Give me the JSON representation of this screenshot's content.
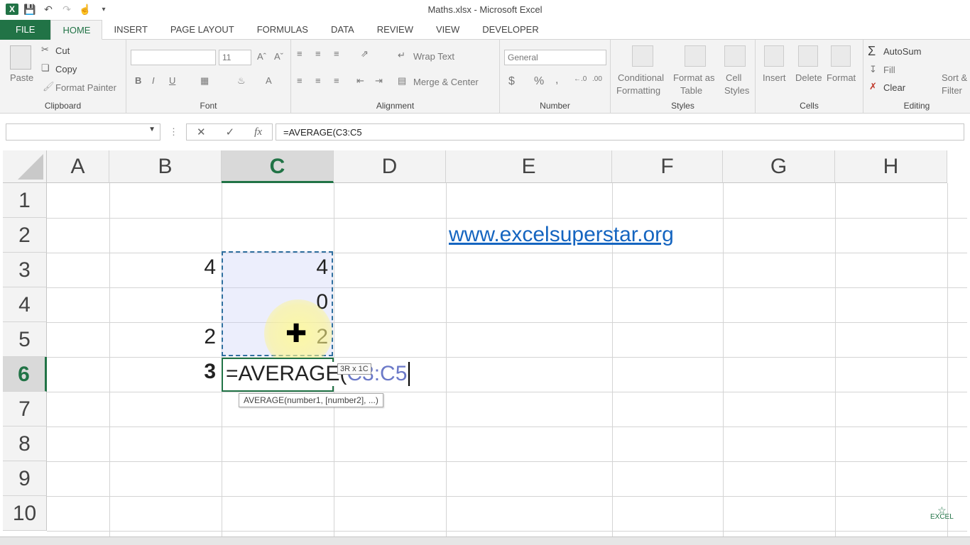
{
  "window": {
    "title": "Maths.xlsx - Microsoft Excel"
  },
  "tabs": [
    "FILE",
    "HOME",
    "INSERT",
    "PAGE LAYOUT",
    "FORMULAS",
    "DATA",
    "REVIEW",
    "VIEW",
    "DEVELOPER"
  ],
  "ribbon": {
    "clipboard": {
      "label": "Clipboard",
      "paste": "Paste",
      "cut": "Cut",
      "copy": "Copy",
      "format_painter": "Format Painter"
    },
    "font": {
      "label": "Font",
      "size": "11",
      "bold": "B",
      "italic": "I",
      "underline": "U"
    },
    "alignment": {
      "label": "Alignment",
      "wrap_text": "Wrap Text",
      "merge_center": "Merge & Center"
    },
    "number": {
      "label": "Number",
      "format": "General",
      "currency": "$",
      "percent": "%",
      "comma": ","
    },
    "styles": {
      "label": "Styles",
      "conditional": "Conditional",
      "formatting": "Formatting",
      "format_as": "Format as",
      "table": "Table",
      "cell": "Cell",
      "cell_styles": "Styles"
    },
    "cells": {
      "label": "Cells",
      "insert": "Insert",
      "delete": "Delete",
      "format": "Format"
    },
    "editing": {
      "label": "Editing",
      "autosum": "AutoSum",
      "fill": "Fill",
      "clear": "Clear",
      "sort": "Sort &",
      "filter": "Filter"
    }
  },
  "formula_bar": {
    "name_box": "",
    "cancel": "✕",
    "enter": "✓",
    "fx": "fx",
    "formula": "=AVERAGE(C3:C5"
  },
  "columns": [
    "A",
    "B",
    "C",
    "D",
    "E",
    "F",
    "G",
    "H"
  ],
  "rows": [
    "1",
    "2",
    "3",
    "4",
    "5",
    "6",
    "7",
    "8",
    "9",
    "10"
  ],
  "cells": {
    "B3": "4",
    "C3": "4",
    "C4": "0",
    "B5": "2",
    "C5": "2",
    "B6": "3",
    "E2": "www.excelsuperstar.org"
  },
  "edit": {
    "prefix": "=AVERAGE(",
    "ref": "C3:C5"
  },
  "tooltips": {
    "size": "3R x 1C",
    "args": "AVERAGE(number1, [number2], ...)"
  },
  "watermark": "EXCEL"
}
